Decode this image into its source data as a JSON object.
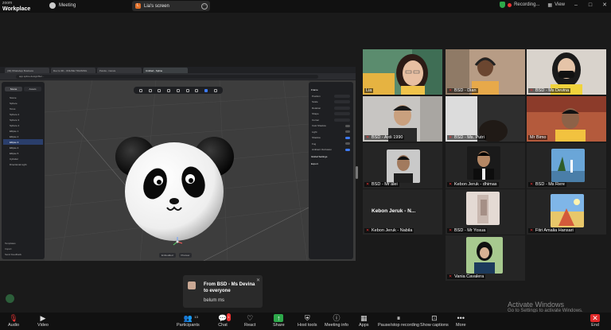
{
  "app": {
    "brand_small": "zoom",
    "brand_large": "Workplace",
    "meeting_tab": "Meeting",
    "screen_tab_initial": "L",
    "screen_tab": "Lia's screen",
    "recording": "Recording...",
    "view": "View"
  },
  "browser": {
    "tabs": [
      "(39) WhatsApp Business",
      "Dev to 3D - ONLINE TRAINING",
      "Panda - Canva",
      "Untitled - Spline"
    ],
    "url": "app.spline.design/file/..."
  },
  "editor": {
    "left_tabs": [
      "Scene",
      "Assets"
    ],
    "tree": [
      "Scene",
      "Sphere",
      "Torus",
      "Sphere 2",
      "Sphere 3",
      "Sphere 4",
      "Ellipse 1",
      "Ellipse 2",
      "Ellipse 3",
      "Ellipse 4",
      "Ellipse 5",
      "Cylinder",
      "Directional Light"
    ],
    "tree_selected": 8,
    "bottom_links": [
      "Templates",
      "Import",
      "Send Feedback"
    ],
    "right_rows": [
      "Position",
      "Scale",
      "Rotation",
      "Shape",
      "Corner",
      "Cast Shadow",
      "Light",
      "Shadow",
      "Fog",
      "Ambient Occlusion"
    ],
    "right_sections": [
      "Frame",
      "Global Settings",
      "Export"
    ],
    "bottom_tabs": [
      "Embedded",
      "Preview"
    ]
  },
  "participants": [
    {
      "name": "Lia",
      "muted": false,
      "active": true
    },
    {
      "name": "BSD - Dian",
      "muted": true
    },
    {
      "name": "BSD - Ms Devina",
      "muted": true
    },
    {
      "name": "BSD - Ardi 1990",
      "muted": true
    },
    {
      "name": "BSD - Ms. Putri",
      "muted": true
    },
    {
      "name": "Mr Bimo",
      "muted": true
    },
    {
      "name": "BSD - Mr alei",
      "muted": true
    },
    {
      "name": "Kebon Jeruk - dhimas",
      "muted": true
    },
    {
      "name": "BSD - Ms Rere",
      "muted": true
    },
    {
      "name": "Kebon Jeruk - N...",
      "muted": false
    },
    {
      "name": "Kebon Jeruk - Nabila",
      "muted": true
    },
    {
      "name": "BSD - Mr Yosua",
      "muted": true
    },
    {
      "name": "Fitri Amalia Hansari",
      "muted": true
    },
    {
      "name": "Vania Cavalera",
      "muted": true
    }
  ],
  "chat_popup": {
    "from": "From BSD - Ms Devina to everyone",
    "message": "belum ms"
  },
  "watermark": {
    "line1": "Activate Windows",
    "line2": "Go to Settings to activate Windows."
  },
  "toolbar": {
    "audio": "Audio",
    "video": "Video",
    "participants": "Participants",
    "participants_count": "13",
    "chat": "Chat",
    "chat_badge": "1",
    "react": "React",
    "share": "Share",
    "host_tools": "Host tools",
    "meeting_info": "Meeting info",
    "apps": "Apps",
    "pause_recording": "Pause/stop recording",
    "show_captions": "Show captions",
    "more": "More",
    "end": "End"
  },
  "colors": {
    "active_speaker": "#3ddc84",
    "end": "#e02828",
    "share": "#2da84a"
  }
}
